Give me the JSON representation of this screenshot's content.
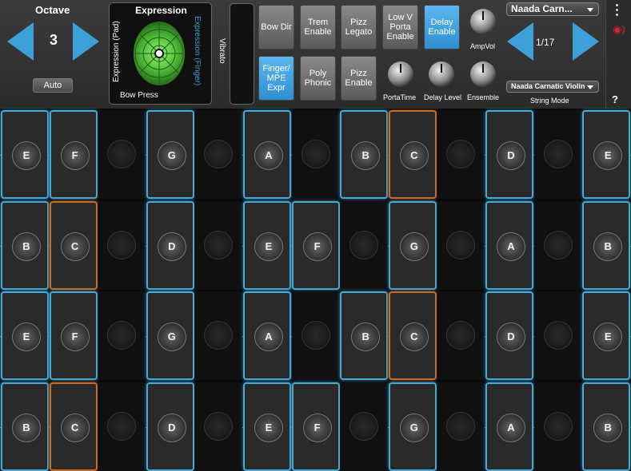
{
  "octave": {
    "title": "Octave",
    "value": "3",
    "auto_label": "Auto"
  },
  "expression": {
    "title": "Expression",
    "pad_label": "Expression (Pad)",
    "finger_label": "Expression (Finger)",
    "bow_label": "Bow Press"
  },
  "vibrato_label": "Vibrato",
  "buttons": [
    {
      "label": "Bow Dir",
      "state": "off"
    },
    {
      "label": "Trem Enable",
      "state": "off"
    },
    {
      "label": "Pizz Legato",
      "state": "off"
    },
    {
      "label": "Low V Porta Enable",
      "state": "off"
    },
    {
      "label": "Delay Enable",
      "state": "on"
    },
    {
      "label": "Finger/ MPE Expr",
      "state": "on"
    },
    {
      "label": "Poly Phonic",
      "state": "off"
    },
    {
      "label": "Pizz Enable",
      "state": "off"
    }
  ],
  "knobs": [
    {
      "label": "AmpVol"
    },
    {
      "label": "PortaTime"
    },
    {
      "label": "Delay Level"
    },
    {
      "label": "Ensemble"
    }
  ],
  "preset": {
    "name": "Naada Carn...",
    "page": "1/17",
    "string_mode_value": "Naada Carnatic Violin",
    "string_mode_label": "String Mode"
  },
  "side": {
    "menu": "more-icon",
    "help": "?"
  },
  "accent": "#3ea0d8",
  "root_color": "#c86c2a",
  "rows": [
    [
      "E",
      "F",
      "",
      "G",
      "",
      "A",
      "",
      "B",
      "C",
      "",
      "D",
      "",
      "E"
    ],
    [
      "B",
      "C",
      "",
      "D",
      "",
      "E",
      "F",
      "",
      "G",
      "",
      "A",
      "",
      "B"
    ],
    [
      "E",
      "F",
      "",
      "G",
      "",
      "A",
      "",
      "B",
      "C",
      "",
      "D",
      "",
      "E"
    ],
    [
      "B",
      "C",
      "",
      "D",
      "",
      "E",
      "F",
      "",
      "G",
      "",
      "A",
      "",
      "B"
    ]
  ]
}
